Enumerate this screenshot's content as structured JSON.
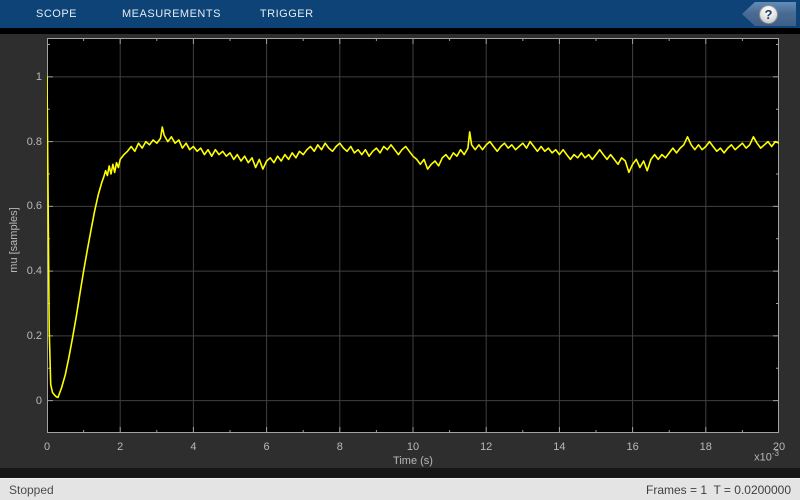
{
  "toolbar": {
    "tabs": [
      {
        "label": "SCOPE"
      },
      {
        "label": "MEASUREMENTS"
      },
      {
        "label": "TRIGGER"
      }
    ],
    "help_label": "?"
  },
  "status_bar": {
    "left": "Stopped",
    "right": "Frames = 1  T = 0.0200000"
  },
  "colors": {
    "toolbar_bg": "#0d4377",
    "toolbar_text": "#e3ecf4",
    "panel_bg": "#2e2e2e",
    "plot_bg": "#000000",
    "grid": "#404040",
    "axis_border": "#a3a3a3",
    "tick": "#9e9e9e",
    "label": "#b8b8b8",
    "trace": "#ffff00",
    "status_bg": "#e4e4e4"
  },
  "chart_data": {
    "type": "line",
    "title": "",
    "xlabel": "Time (s)",
    "ylabel": "mu [samples]",
    "x_multiplier": "x10",
    "x_multiplier_exp": "-3",
    "x_unit_scale": 0.001,
    "xlim": [
      0,
      20
    ],
    "ylim": [
      -0.1,
      1.12
    ],
    "grid": true,
    "legend": "none",
    "x_major_ticks": [
      0,
      2,
      4,
      6,
      8,
      10,
      12,
      14,
      16,
      18,
      20
    ],
    "x_tick_labels": [
      "0",
      "2",
      "4",
      "6",
      "8",
      "10",
      "12",
      "14",
      "16",
      "18",
      "20"
    ],
    "x_minor_ticks": [
      1,
      3,
      5,
      7,
      9,
      11,
      13,
      15,
      17,
      19
    ],
    "y_major_ticks": [
      0,
      0.2,
      0.4,
      0.6,
      0.8,
      1
    ],
    "y_tick_labels": [
      "0",
      "0.2",
      "0.4",
      "0.6",
      "0.8",
      "1"
    ],
    "y_minor_ticks": [
      0.1,
      0.3,
      0.5,
      0.7,
      0.9,
      1.1
    ],
    "series": [
      {
        "name": "mu",
        "color": "#ffff00",
        "points": [
          [
            0,
            1.0
          ],
          [
            0.03,
            0.62
          ],
          [
            0.06,
            0.22
          ],
          [
            0.1,
            0.05
          ],
          [
            0.15,
            0.025
          ],
          [
            0.2,
            0.018
          ],
          [
            0.25,
            0.012
          ],
          [
            0.3,
            0.01
          ],
          [
            0.35,
            0.025
          ],
          [
            0.4,
            0.04
          ],
          [
            0.5,
            0.08
          ],
          [
            0.6,
            0.135
          ],
          [
            0.7,
            0.195
          ],
          [
            0.8,
            0.26
          ],
          [
            0.9,
            0.33
          ],
          [
            1.0,
            0.4
          ],
          [
            1.1,
            0.465
          ],
          [
            1.2,
            0.525
          ],
          [
            1.3,
            0.585
          ],
          [
            1.4,
            0.635
          ],
          [
            1.5,
            0.675
          ],
          [
            1.55,
            0.69
          ],
          [
            1.6,
            0.71
          ],
          [
            1.65,
            0.695
          ],
          [
            1.7,
            0.725
          ],
          [
            1.75,
            0.7
          ],
          [
            1.8,
            0.73
          ],
          [
            1.85,
            0.705
          ],
          [
            1.9,
            0.735
          ],
          [
            1.95,
            0.72
          ],
          [
            2.0,
            0.745
          ],
          [
            2.1,
            0.76
          ],
          [
            2.2,
            0.77
          ],
          [
            2.3,
            0.785
          ],
          [
            2.4,
            0.77
          ],
          [
            2.5,
            0.795
          ],
          [
            2.6,
            0.78
          ],
          [
            2.7,
            0.8
          ],
          [
            2.8,
            0.79
          ],
          [
            2.9,
            0.805
          ],
          [
            3.0,
            0.795
          ],
          [
            3.1,
            0.81
          ],
          [
            3.15,
            0.845
          ],
          [
            3.2,
            0.82
          ],
          [
            3.3,
            0.8
          ],
          [
            3.4,
            0.815
          ],
          [
            3.5,
            0.795
          ],
          [
            3.6,
            0.805
          ],
          [
            3.7,
            0.78
          ],
          [
            3.8,
            0.795
          ],
          [
            3.9,
            0.775
          ],
          [
            4.0,
            0.785
          ],
          [
            4.1,
            0.77
          ],
          [
            4.2,
            0.78
          ],
          [
            4.3,
            0.76
          ],
          [
            4.4,
            0.775
          ],
          [
            4.5,
            0.755
          ],
          [
            4.6,
            0.775
          ],
          [
            4.7,
            0.76
          ],
          [
            4.8,
            0.77
          ],
          [
            4.9,
            0.755
          ],
          [
            5.0,
            0.765
          ],
          [
            5.1,
            0.745
          ],
          [
            5.2,
            0.76
          ],
          [
            5.3,
            0.74
          ],
          [
            5.4,
            0.755
          ],
          [
            5.5,
            0.735
          ],
          [
            5.6,
            0.75
          ],
          [
            5.7,
            0.72
          ],
          [
            5.8,
            0.745
          ],
          [
            5.9,
            0.715
          ],
          [
            6.0,
            0.74
          ],
          [
            6.1,
            0.75
          ],
          [
            6.2,
            0.735
          ],
          [
            6.3,
            0.755
          ],
          [
            6.4,
            0.74
          ],
          [
            6.5,
            0.76
          ],
          [
            6.6,
            0.745
          ],
          [
            6.7,
            0.765
          ],
          [
            6.8,
            0.75
          ],
          [
            6.9,
            0.77
          ],
          [
            7.0,
            0.76
          ],
          [
            7.1,
            0.775
          ],
          [
            7.2,
            0.785
          ],
          [
            7.3,
            0.77
          ],
          [
            7.4,
            0.79
          ],
          [
            7.5,
            0.775
          ],
          [
            7.6,
            0.795
          ],
          [
            7.7,
            0.78
          ],
          [
            7.8,
            0.77
          ],
          [
            7.9,
            0.785
          ],
          [
            8.0,
            0.795
          ],
          [
            8.1,
            0.78
          ],
          [
            8.2,
            0.77
          ],
          [
            8.3,
            0.785
          ],
          [
            8.4,
            0.765
          ],
          [
            8.5,
            0.775
          ],
          [
            8.6,
            0.76
          ],
          [
            8.7,
            0.775
          ],
          [
            8.8,
            0.755
          ],
          [
            8.9,
            0.77
          ],
          [
            9.0,
            0.78
          ],
          [
            9.1,
            0.765
          ],
          [
            9.2,
            0.785
          ],
          [
            9.3,
            0.775
          ],
          [
            9.4,
            0.79
          ],
          [
            9.5,
            0.775
          ],
          [
            9.6,
            0.76
          ],
          [
            9.7,
            0.775
          ],
          [
            9.8,
            0.785
          ],
          [
            9.9,
            0.77
          ],
          [
            10.0,
            0.755
          ],
          [
            10.1,
            0.745
          ],
          [
            10.2,
            0.73
          ],
          [
            10.3,
            0.745
          ],
          [
            10.4,
            0.715
          ],
          [
            10.5,
            0.73
          ],
          [
            10.6,
            0.74
          ],
          [
            10.7,
            0.725
          ],
          [
            10.8,
            0.75
          ],
          [
            10.9,
            0.76
          ],
          [
            11.0,
            0.745
          ],
          [
            11.1,
            0.765
          ],
          [
            11.2,
            0.755
          ],
          [
            11.3,
            0.775
          ],
          [
            11.4,
            0.76
          ],
          [
            11.5,
            0.78
          ],
          [
            11.55,
            0.83
          ],
          [
            11.6,
            0.79
          ],
          [
            11.7,
            0.775
          ],
          [
            11.8,
            0.79
          ],
          [
            11.9,
            0.775
          ],
          [
            12.0,
            0.79
          ],
          [
            12.1,
            0.8
          ],
          [
            12.2,
            0.785
          ],
          [
            12.3,
            0.77
          ],
          [
            12.4,
            0.785
          ],
          [
            12.5,
            0.795
          ],
          [
            12.6,
            0.78
          ],
          [
            12.7,
            0.79
          ],
          [
            12.8,
            0.775
          ],
          [
            12.9,
            0.785
          ],
          [
            13.0,
            0.795
          ],
          [
            13.1,
            0.78
          ],
          [
            13.2,
            0.8
          ],
          [
            13.3,
            0.785
          ],
          [
            13.4,
            0.77
          ],
          [
            13.5,
            0.785
          ],
          [
            13.6,
            0.77
          ],
          [
            13.7,
            0.78
          ],
          [
            13.8,
            0.765
          ],
          [
            13.9,
            0.775
          ],
          [
            14.0,
            0.76
          ],
          [
            14.1,
            0.775
          ],
          [
            14.2,
            0.76
          ],
          [
            14.3,
            0.745
          ],
          [
            14.4,
            0.76
          ],
          [
            14.5,
            0.75
          ],
          [
            14.6,
            0.765
          ],
          [
            14.7,
            0.75
          ],
          [
            14.8,
            0.76
          ],
          [
            14.9,
            0.745
          ],
          [
            15.0,
            0.76
          ],
          [
            15.1,
            0.775
          ],
          [
            15.2,
            0.76
          ],
          [
            15.3,
            0.745
          ],
          [
            15.4,
            0.76
          ],
          [
            15.5,
            0.745
          ],
          [
            15.6,
            0.73
          ],
          [
            15.7,
            0.75
          ],
          [
            15.8,
            0.74
          ],
          [
            15.9,
            0.705
          ],
          [
            16.0,
            0.73
          ],
          [
            16.1,
            0.745
          ],
          [
            16.2,
            0.72
          ],
          [
            16.3,
            0.74
          ],
          [
            16.4,
            0.71
          ],
          [
            16.5,
            0.745
          ],
          [
            16.6,
            0.76
          ],
          [
            16.7,
            0.745
          ],
          [
            16.8,
            0.76
          ],
          [
            16.9,
            0.75
          ],
          [
            17.0,
            0.765
          ],
          [
            17.1,
            0.78
          ],
          [
            17.2,
            0.765
          ],
          [
            17.3,
            0.78
          ],
          [
            17.4,
            0.79
          ],
          [
            17.5,
            0.815
          ],
          [
            17.6,
            0.79
          ],
          [
            17.7,
            0.775
          ],
          [
            17.8,
            0.79
          ],
          [
            17.9,
            0.775
          ],
          [
            18.0,
            0.785
          ],
          [
            18.1,
            0.8
          ],
          [
            18.2,
            0.785
          ],
          [
            18.3,
            0.77
          ],
          [
            18.4,
            0.78
          ],
          [
            18.5,
            0.765
          ],
          [
            18.6,
            0.78
          ],
          [
            18.7,
            0.79
          ],
          [
            18.8,
            0.775
          ],
          [
            18.9,
            0.785
          ],
          [
            19.0,
            0.795
          ],
          [
            19.1,
            0.78
          ],
          [
            19.2,
            0.79
          ],
          [
            19.3,
            0.815
          ],
          [
            19.4,
            0.795
          ],
          [
            19.5,
            0.78
          ],
          [
            19.6,
            0.79
          ],
          [
            19.7,
            0.8
          ],
          [
            19.8,
            0.785
          ],
          [
            19.9,
            0.8
          ],
          [
            20.0,
            0.795
          ]
        ]
      }
    ]
  }
}
